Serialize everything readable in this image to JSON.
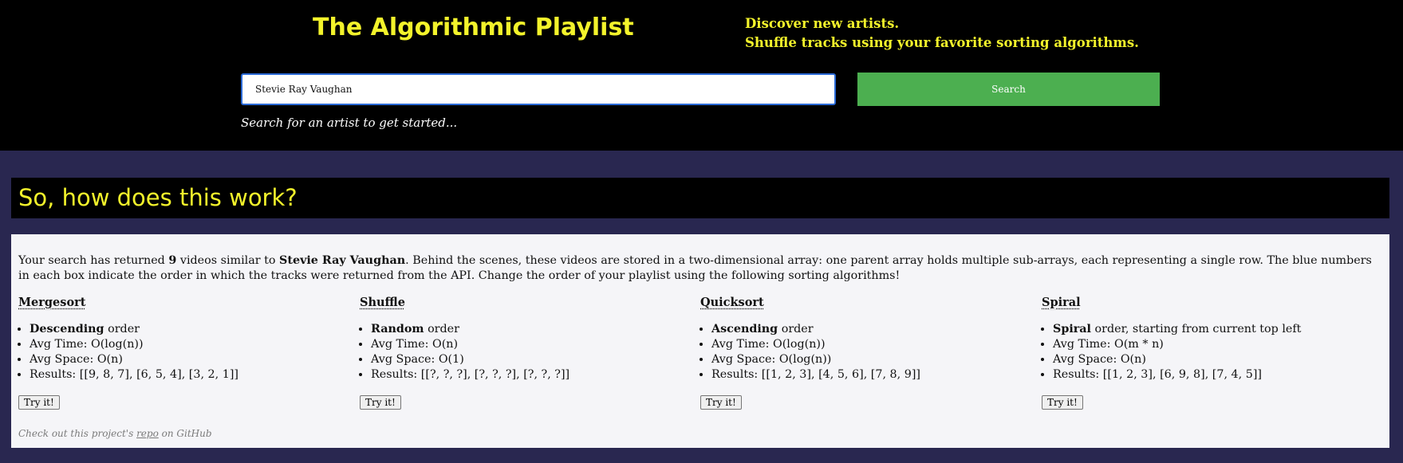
{
  "header": {
    "title": "The Algorithmic Playlist",
    "tagline_line1": "Discover new artists.",
    "tagline_line2": "Shuffle tracks using your favorite sorting algorithms.",
    "search_value": "Stevie Ray Vaughan",
    "search_button": "Search",
    "hint": "Search for an artist to get started..."
  },
  "how": {
    "title": "So, how does this work?"
  },
  "intro": {
    "p1": "Your search has returned ",
    "count": "9",
    "p2": " videos similar to ",
    "artist": "Stevie Ray Vaughan",
    "p3": ". Behind the scenes, these videos are stored in a two-dimensional array: one parent array holds multiple sub-arrays, each representing a single row. The blue numbers in each box indicate the order in which the tracks were returned from the API. Change the order of your playlist using the following sorting algorithms!"
  },
  "algorithms": [
    {
      "name": "Mergesort",
      "order_bold": "Descending",
      "order_rest": " order",
      "time": "Avg Time: O(log(n))",
      "space": "Avg Space: O(n)",
      "results": "Results: [[9, 8, 7], [6, 5, 4], [3, 2, 1]]",
      "button": "Try it!"
    },
    {
      "name": "Shuffle",
      "order_bold": "Random",
      "order_rest": " order",
      "time": "Avg Time: O(n)",
      "space": "Avg Space: O(1)",
      "results": "Results: [[?, ?, ?], [?, ?, ?], [?, ?, ?]]",
      "button": "Try it!"
    },
    {
      "name": "Quicksort",
      "order_bold": "Ascending",
      "order_rest": " order",
      "time": "Avg Time: O(log(n))",
      "space": "Avg Space: O(log(n))",
      "results": "Results: [[1, 2, 3], [4, 5, 6], [7, 8, 9]]",
      "button": "Try it!"
    },
    {
      "name": "Spiral",
      "order_bold": "Spiral",
      "order_rest": " order, starting from current top left",
      "time": "Avg Time: O(m * n)",
      "space": "Avg Space: O(n)",
      "results": "Results: [[1, 2, 3], [6, 9, 8], [7, 4, 5]]",
      "button": "Try it!"
    }
  ],
  "footer": {
    "pre": "Check out this project's ",
    "link": "repo",
    "post": " on GitHub"
  }
}
